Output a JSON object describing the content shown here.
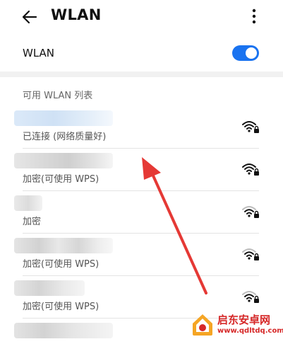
{
  "header": {
    "title": "WLAN",
    "back_icon": "arrow-left-icon",
    "more_icon": "more-vertical-icon"
  },
  "wlan_toggle": {
    "label": "WLAN",
    "enabled": true,
    "accent_color": "#1a73f0"
  },
  "networks": {
    "header": "可用 WLAN 列表",
    "items": [
      {
        "status": "已连接 (网络质量好)",
        "secured": true,
        "signal_bars": 3,
        "icon": "wifi-lock-icon"
      },
      {
        "status": "加密(可使用 WPS)",
        "secured": true,
        "signal_bars": 3,
        "icon": "wifi-lock-icon"
      },
      {
        "status": "加密",
        "secured": true,
        "signal_bars": 2,
        "icon": "wifi-lock-icon"
      },
      {
        "status": "加密(可使用 WPS)",
        "secured": true,
        "signal_bars": 2,
        "icon": "wifi-lock-icon"
      },
      {
        "status": "加密(可使用 WPS)",
        "secured": true,
        "signal_bars": 2,
        "icon": "wifi-lock-icon"
      },
      {
        "status": "",
        "secured": true,
        "signal_bars": 2,
        "icon": "wifi-lock-icon"
      }
    ]
  },
  "watermark": {
    "title": "启东安卓网",
    "url": "www.qdltdq.com",
    "brand_color": "#d62828"
  },
  "annotation": {
    "icon": "red-arrow-icon",
    "color": "#e53935"
  }
}
